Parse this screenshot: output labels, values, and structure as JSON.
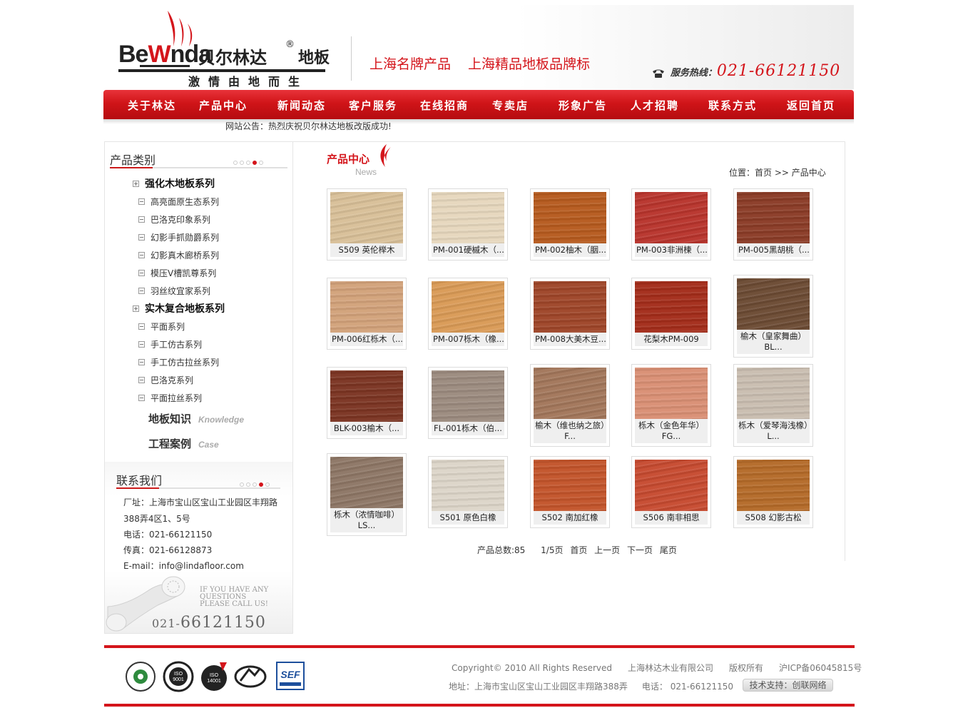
{
  "header": {
    "logo": {
      "brand_pre": "Be",
      "brand_post": "nda",
      "brand_cn": "贝尔林达",
      "reg": "®",
      "floor": "地板",
      "tagline": "激情由地而生"
    },
    "slogans": [
      "上海名牌产品",
      "上海精品地板品牌标"
    ],
    "hotline_label": "服务热线：",
    "hotline_number": "021-66121150"
  },
  "nav": [
    "关于林达",
    "产品中心",
    "新闻动态",
    "客户服务",
    "在线招商",
    "专卖店",
    "形象广告",
    "人才招聘",
    "联系方式",
    "返回首页"
  ],
  "notice": "网站公告：热烈庆祝贝尔林达地板改版成功!",
  "sidebar": {
    "category_title": "产品类别",
    "groups": [
      {
        "name": "强化木地板系列",
        "items": [
          "高亮面原生态系列",
          "巴洛克印象系列",
          "幻影手抓勋爵系列",
          "幻影真木廊桥系列",
          "模压V槽凯尊系列",
          "羽丝纹宜家系列"
        ]
      },
      {
        "name": "实木复合地板系列",
        "items": [
          "平面系列",
          "手工仿古系列",
          "手工仿古拉丝系列",
          "巴洛克系列",
          "平面拉丝系列"
        ]
      }
    ],
    "links": [
      {
        "cn": "地板知识",
        "en": "Knowledge"
      },
      {
        "cn": "工程案例",
        "en": "Case"
      }
    ],
    "contact": {
      "title": "联系我们",
      "address_1": "厂址：上海市宝山区宝山工业园区丰翔路",
      "address_2": "388弄4区1、5号",
      "phone": "电话：021-66121150",
      "fax": "传真：021-66128873",
      "email": "E-mail：info@lindafloor.com",
      "banner_en": [
        "IF YOU HAVE ANY",
        "QUESTIONS",
        "PLEASE CALL US!"
      ],
      "banner_prefix": "021-",
      "banner_number": "66121150"
    }
  },
  "main": {
    "title": "产品中心",
    "title_en": "News",
    "breadcrumb": {
      "label": "位置：",
      "home": "首页",
      "sep": ">>",
      "current": "产品中心"
    },
    "products": [
      {
        "name": "S509 英伦榉木",
        "color": "#d8bf98"
      },
      {
        "name": "PM-001硬槭木（...",
        "color": "#e6d7bd"
      },
      {
        "name": "PM-002柚木（胭...",
        "color": "#b65a1e"
      },
      {
        "name": "PM-003非洲楝（...",
        "color": "#b8342c"
      },
      {
        "name": "PM-005黑胡桃（...",
        "color": "#8a3b26"
      },
      {
        "name": "PM-006红栎木（...",
        "color": "#d2a27a"
      },
      {
        "name": "PM-007栎木（橡...",
        "color": "#d99a56"
      },
      {
        "name": "PM-008大美木豆...",
        "color": "#9e4528"
      },
      {
        "name": "花梨木PM-009",
        "color": "#a32c1a"
      },
      {
        "name": "榆木（皇家舞曲）BL...",
        "color": "#6b4a33"
      },
      {
        "name": "BLK-003榆木（...",
        "color": "#7b3422"
      },
      {
        "name": "FL-001栎木（伯...",
        "color": "#9b8a7e"
      },
      {
        "name": "榆木（维也纳之旅）F...",
        "color": "#a2765a"
      },
      {
        "name": "栎木（金色年华）FG...",
        "color": "#d98f74"
      },
      {
        "name": "栎木（爱琴海浅橡）L...",
        "color": "#c9bdb0"
      },
      {
        "name": "栎木（浓情咖啡）LS...",
        "color": "#8d7665"
      },
      {
        "name": "S501 原色白橡",
        "color": "#dcd5c8"
      },
      {
        "name": "S502 南加红橡",
        "color": "#c2542a"
      },
      {
        "name": "S506 南非相思",
        "color": "#c64a30"
      },
      {
        "name": "S508 幻影古松",
        "color": "#b46a28"
      }
    ],
    "pager": {
      "total": "产品总数:85",
      "page": "1/5页",
      "first": "首页",
      "prev": "上一页",
      "next": "下一页",
      "last": "尾页"
    }
  },
  "footer": {
    "certs": [
      "cert-1",
      "ISO 9001",
      "ISO 14001",
      "cert-4",
      "SEF"
    ],
    "copyright": "Copyright© 2010  All Rights Reserved",
    "company": "上海林达木业有限公司",
    "rights": "版权所有",
    "icp": "沪ICP备06045815号",
    "address": "地址：上海市宝山区宝山工业园区丰翔路388弄",
    "phone": "电话：  021-66121150",
    "tech": "技术支持：创联网络"
  },
  "colors": {
    "brand_red": "#d4151b",
    "nav_red": "#d01418"
  }
}
